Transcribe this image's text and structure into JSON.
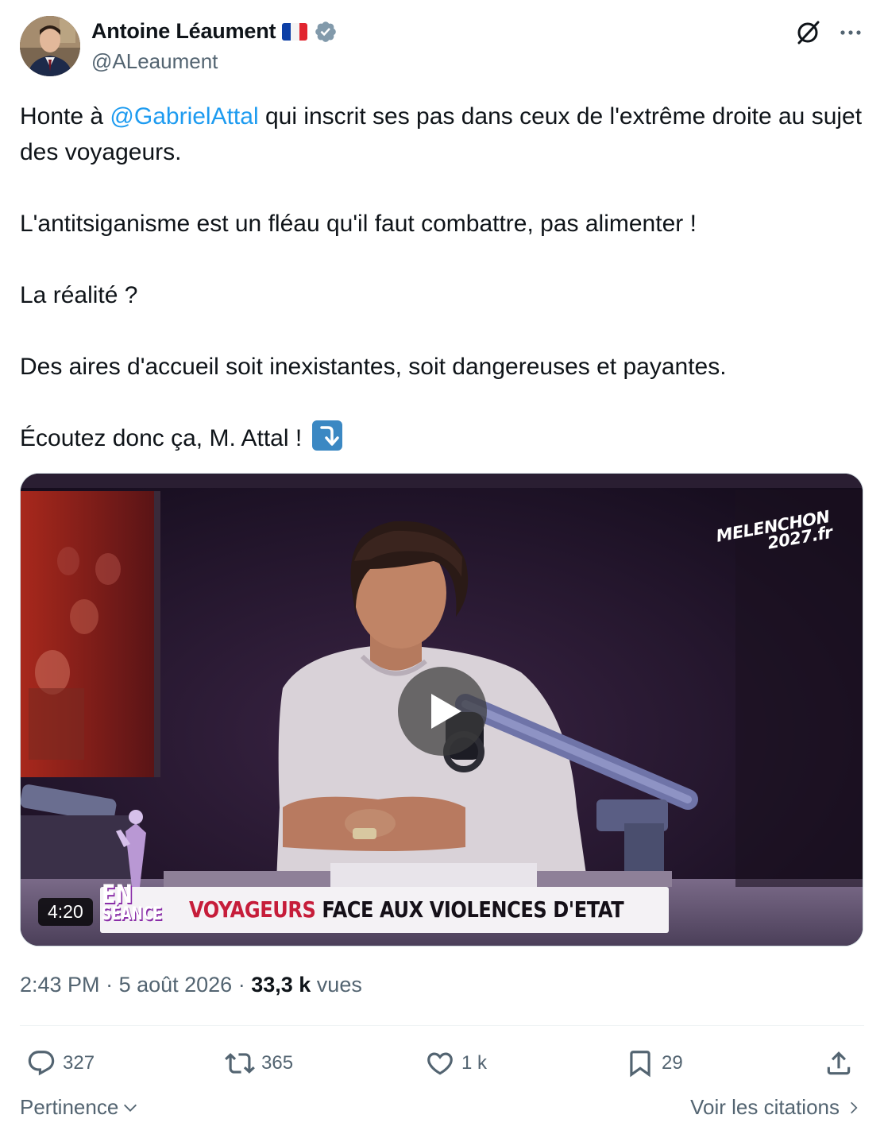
{
  "author": {
    "display_name": "Antoine Léaument",
    "handle": "@ALeaument",
    "verified": true,
    "flag": "french-flag-emoji"
  },
  "tweet": {
    "line1_before": "Honte à ",
    "mention": "@GabrielAttal",
    "line1_after": " qui inscrit ses pas dans ceux de l'extrême droite au sujet des voyageurs.",
    "paragraph2": "L'antitsiganisme est un fléau qu'il faut combattre, pas alimenter !",
    "paragraph3": "La réalité ?",
    "paragraph4": "Des aires d'accueil soit inexistantes, soit dangereuses et payantes.",
    "paragraph5": "Écoutez donc ça, M. Attal !",
    "emoji": "right-arrow-curving-down-emoji"
  },
  "video": {
    "watermark_line1": "MELENCHON",
    "watermark_line2": "2027.fr",
    "show_logo_line1": "EN",
    "show_logo_line2": "SÉANCE",
    "banner_red": "VOYAGEURS",
    "banner_black": "FACE AUX VIOLENCES D'ETAT",
    "duration": "4:20"
  },
  "meta": {
    "time": "2:43 PM",
    "separator": " · ",
    "date": "5 août 2026",
    "views_count": "33,3 k",
    "views_label": "vues"
  },
  "actions": {
    "replies": "327",
    "reposts": "365",
    "likes": "1 k",
    "bookmarks": "29"
  },
  "footer": {
    "sort_label": "Pertinence",
    "quotes_label": "Voir les citations"
  },
  "colors": {
    "accent": "#1d9bf0",
    "text_primary": "#0f1419",
    "text_secondary": "#536471",
    "verified_badge": "#829aab",
    "banner_red": "#c61d3a"
  }
}
